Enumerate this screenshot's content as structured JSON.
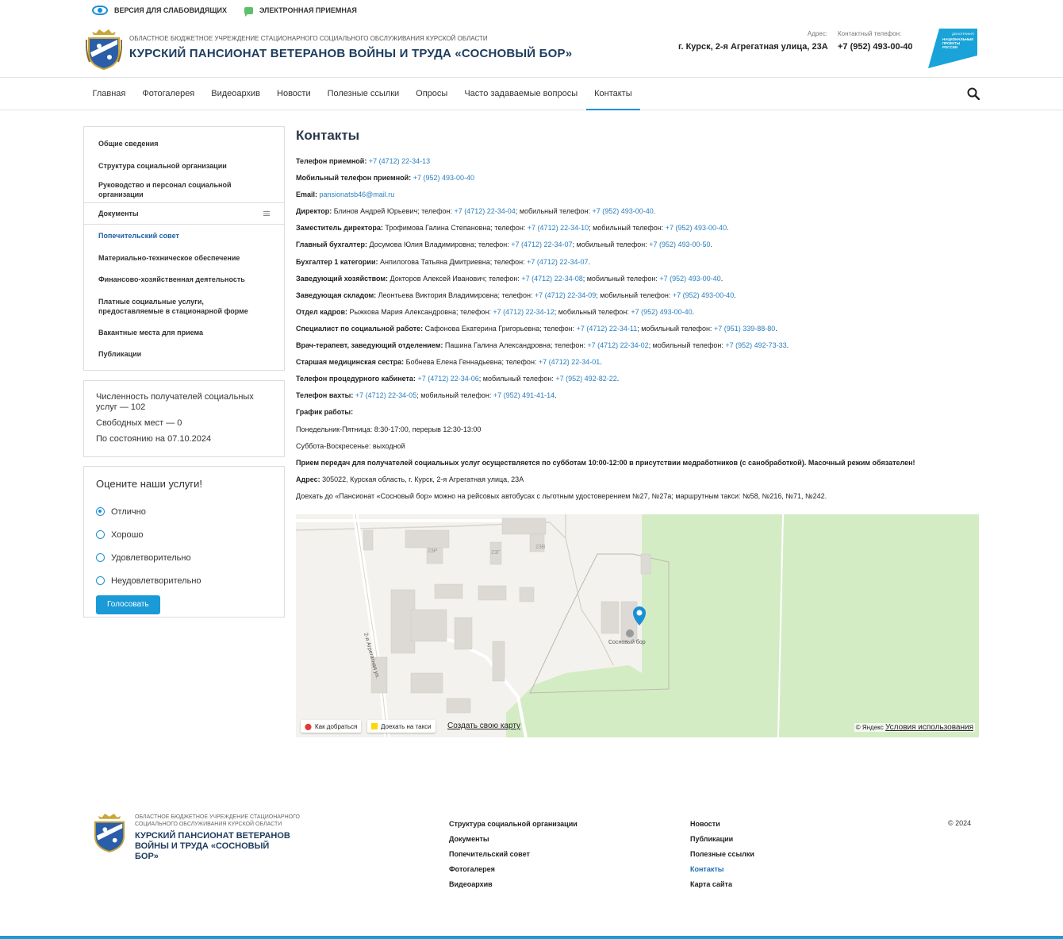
{
  "util": {
    "low_vision": "ВЕРСИЯ ДЛЯ СЛАБОВИДЯЩИХ",
    "reception": "ЭЛЕКТРОННАЯ ПРИЕМНАЯ"
  },
  "header": {
    "org_subtitle": "ОБЛАСТНОЕ БЮДЖЕТНОЕ УЧРЕЖДЕНИЕ СТАЦИОНАРНОГО СОЦИАЛЬНОГО ОБСЛУЖИВАНИЯ КУРСКОЙ ОБЛАСТИ",
    "org_title": "КУРСКИЙ ПАНСИОНАТ ВЕТЕРАНОВ ВОЙНЫ И ТРУДА «СОСНОВЫЙ БОР»",
    "address_label": "Адрес:",
    "address": "г. Курск, 2-я Агрегатная улица, 23А",
    "phone_label": "Контактный телефон:",
    "phone": "+7 (952) 493-00-40",
    "natproj_lines": [
      "ДЕМОГРАФИЯ",
      "НАЦИОНАЛЬНЫЕ",
      "ПРОЕКТЫ",
      "РОССИИ"
    ]
  },
  "nav": {
    "items": [
      "Главная",
      "Фотогалерея",
      "Видеоархив",
      "Новости",
      "Полезные ссылки",
      "Опросы",
      "Часто задаваемые вопросы",
      "Контакты"
    ],
    "active": "Контакты"
  },
  "sidebar": {
    "items": [
      {
        "label": "Общие сведения"
      },
      {
        "label": "Структура социальной организации"
      },
      {
        "label": "Руководство и персонал социальной организации"
      },
      {
        "label": "Документы"
      },
      {
        "label": "Попечительский совет"
      },
      {
        "label": "Материально-техническое обеспечение"
      },
      {
        "label": "Финансово-хозяйственная деятельность"
      },
      {
        "label": "Платные социальные услуги, предоставляемые в стационарной форме"
      },
      {
        "label": "Вакантные места для приема"
      },
      {
        "label": "Публикации"
      }
    ]
  },
  "stats": {
    "recipients": "Численность получателей социальных услуг — 102",
    "free_places": "Свободных мест — 0",
    "as_of": "По состоянию на 07.10.2024"
  },
  "poll": {
    "title": "Оцените наши услуги!",
    "options": [
      "Отлично",
      "Хорошо",
      "Удовлетворительно",
      "Неудовлетворительно"
    ],
    "selected": "Отлично",
    "button": "Голосовать"
  },
  "content": {
    "title": "Контакты",
    "lines": [
      {
        "label": "Телефон приемной:",
        "segments": [
          {
            "t": " "
          },
          {
            "link": "+7 (4712) 22-34-13"
          }
        ]
      },
      {
        "label": "Мобильный телефон приемной:",
        "segments": [
          {
            "t": " "
          },
          {
            "link": "+7 (952) 493-00-40"
          }
        ]
      },
      {
        "label": "Email:",
        "segments": [
          {
            "t": " "
          },
          {
            "link": "pansionatsb46@mail.ru"
          }
        ]
      },
      {
        "label": "Директор:",
        "segments": [
          {
            "t": " Блинов Андрей Юрьевич; телефон: "
          },
          {
            "link": "+7 (4712) 22-34-04"
          },
          {
            "t": "; мобильный телефон: "
          },
          {
            "link": "+7 (952) 493-00-40"
          },
          {
            "t": "."
          }
        ]
      },
      {
        "label": "Заместитель директора:",
        "segments": [
          {
            "t": " Трофимова Галина Степановна; телефон: "
          },
          {
            "link": "+7 (4712) 22-34-10"
          },
          {
            "t": "; мобильный телефон: "
          },
          {
            "link": "+7 (952) 493-00-40"
          },
          {
            "t": "."
          }
        ]
      },
      {
        "label": "Главный бухгалтер:",
        "segments": [
          {
            "t": " Досумова Юлия Владимировна; телефон: "
          },
          {
            "link": "+7 (4712) 22-34-07"
          },
          {
            "t": "; мобильный телефон: "
          },
          {
            "link": "+7 (952) 493-00-50"
          },
          {
            "t": "."
          }
        ]
      },
      {
        "label": "Бухгалтер 1 категории:",
        "segments": [
          {
            "t": " Анпилогова Татьяна Дмитриевна; телефон: "
          },
          {
            "link": "+7 (4712) 22-34-07"
          },
          {
            "t": "."
          }
        ]
      },
      {
        "label": "Заведующий хозяйством:",
        "segments": [
          {
            "t": " Докторов Алексей Иванович; телефон: "
          },
          {
            "link": "+7 (4712) 22-34-08"
          },
          {
            "t": "; мобильный телефон: "
          },
          {
            "link": "+7 (952) 493-00-40"
          },
          {
            "t": "."
          }
        ]
      },
      {
        "label": "Заведующая складом:",
        "segments": [
          {
            "t": " Леонтьева Виктория Владимировна; телефон: "
          },
          {
            "link": "+7 (4712) 22-34-09"
          },
          {
            "t": "; мобильный телефон: "
          },
          {
            "link": "+7 (952) 493-00-40"
          },
          {
            "t": "."
          }
        ]
      },
      {
        "label": "Отдел кадров:",
        "segments": [
          {
            "t": " Рыжкова Мария Александровна; телефон: "
          },
          {
            "link": "+7 (4712) 22-34-12"
          },
          {
            "t": "; мобильный телефон: "
          },
          {
            "link": "+7 (952) 493-00-40"
          },
          {
            "t": "."
          }
        ]
      },
      {
        "label": "Специалист по социальной работе:",
        "segments": [
          {
            "t": " Сафонова Екатерина Григорьевна; телефон: "
          },
          {
            "link": "+7 (4712) 22-34-11"
          },
          {
            "t": "; мобильный телефон: "
          },
          {
            "link": "+7 (951) 339-88-80"
          },
          {
            "t": "."
          }
        ]
      },
      {
        "label": "Врач-терапевт, заведующий отделением:",
        "segments": [
          {
            "t": " Пашина Галина Александровна; телефон: "
          },
          {
            "link": "+7 (4712) 22-34-02"
          },
          {
            "t": "; мобильный телефон: "
          },
          {
            "link": "+7 (952) 492-73-33"
          },
          {
            "t": "."
          }
        ]
      },
      {
        "label": "Старшая медицинская сестра:",
        "segments": [
          {
            "t": " Бобнева Елена Геннадьевна; телефон: "
          },
          {
            "link": "+7 (4712) 22-34-01"
          },
          {
            "t": "."
          }
        ]
      },
      {
        "label": "Телефон процедурного кабинета:",
        "segments": [
          {
            "t": " "
          },
          {
            "link": "+7 (4712) 22-34-06"
          },
          {
            "t": "; мобильный телефон: "
          },
          {
            "link": "+7 (952) 492-82-22"
          },
          {
            "t": "."
          }
        ]
      },
      {
        "label": "Телефон вахты:",
        "segments": [
          {
            "t": " "
          },
          {
            "link": "+7 (4712) 22-34-05"
          },
          {
            "t": "; мобильный телефон: "
          },
          {
            "link": "+7 (952) 491-41-14"
          },
          {
            "t": "."
          }
        ]
      },
      {
        "label": "График работы:",
        "segments": []
      },
      {
        "label": "",
        "segments": [
          {
            "t": "Понедельник-Пятница: 8:30-17:00, перерыв 12:30-13:00"
          }
        ]
      },
      {
        "label": "",
        "segments": [
          {
            "t": "Суббота-Воскресенье: выходной"
          }
        ]
      },
      {
        "label": "Прием передач для получателей социальных услуг осуществляется по субботам 10:00-12:00 в присутствии медработников (с санобработкой).  Масочный режим обязателен!",
        "segments": []
      },
      {
        "label": "Адрес:",
        "segments": [
          {
            "t": " 305022, Курская область, г. Курск, 2-я Агрегатная улица, 23А"
          }
        ]
      },
      {
        "label": "",
        "segments": [
          {
            "t": "Доехать до «Пансионат «Сосновый бор» можно на рейсовых автобусах с льготным удостоверением №27, №27а; маршрутным такси: №58, №216, №71, №242."
          }
        ]
      }
    ]
  },
  "map": {
    "labels": {
      "b23r": "23Р",
      "b23g": "23Г",
      "b23v": "23В",
      "street": "2-я Агрегатная ул.",
      "place": "Сосновый бор"
    },
    "route_btn": "Как добраться",
    "taxi_btn": "Доехать на такси",
    "create_link": "Создать свою карту",
    "copyright": "© Яндекс",
    "terms": "Условия использования",
    "colors": {
      "green": "#d4ecc4",
      "base": "#f4f2ee",
      "building": "#dddad5",
      "pin": "#1a8fd6"
    }
  },
  "footer": {
    "org_subtitle": "ОБЛАСТНОЕ БЮДЖЕТНОЕ УЧРЕЖДЕНИЕ СТАЦИОНАРНОГО СОЦИАЛЬНОГО ОБСЛУЖИВАНИЯ КУРСКОЙ ОБЛАСТИ",
    "org_title": "КУРСКИЙ ПАНСИОНАТ ВЕТЕРАНОВ ВОЙНЫ И ТРУДА «СОСНОВЫЙ БОР»",
    "col1": [
      "Структура социальной организации",
      "Документы",
      "Попечительский совет",
      "Фотогалерея",
      "Видеоархив"
    ],
    "col2": [
      "Новости",
      "Публикации",
      "Полезные ссылки",
      "Контакты",
      "Карта сайта"
    ],
    "col2_active": "Контакты",
    "copyright": "© 2024"
  }
}
